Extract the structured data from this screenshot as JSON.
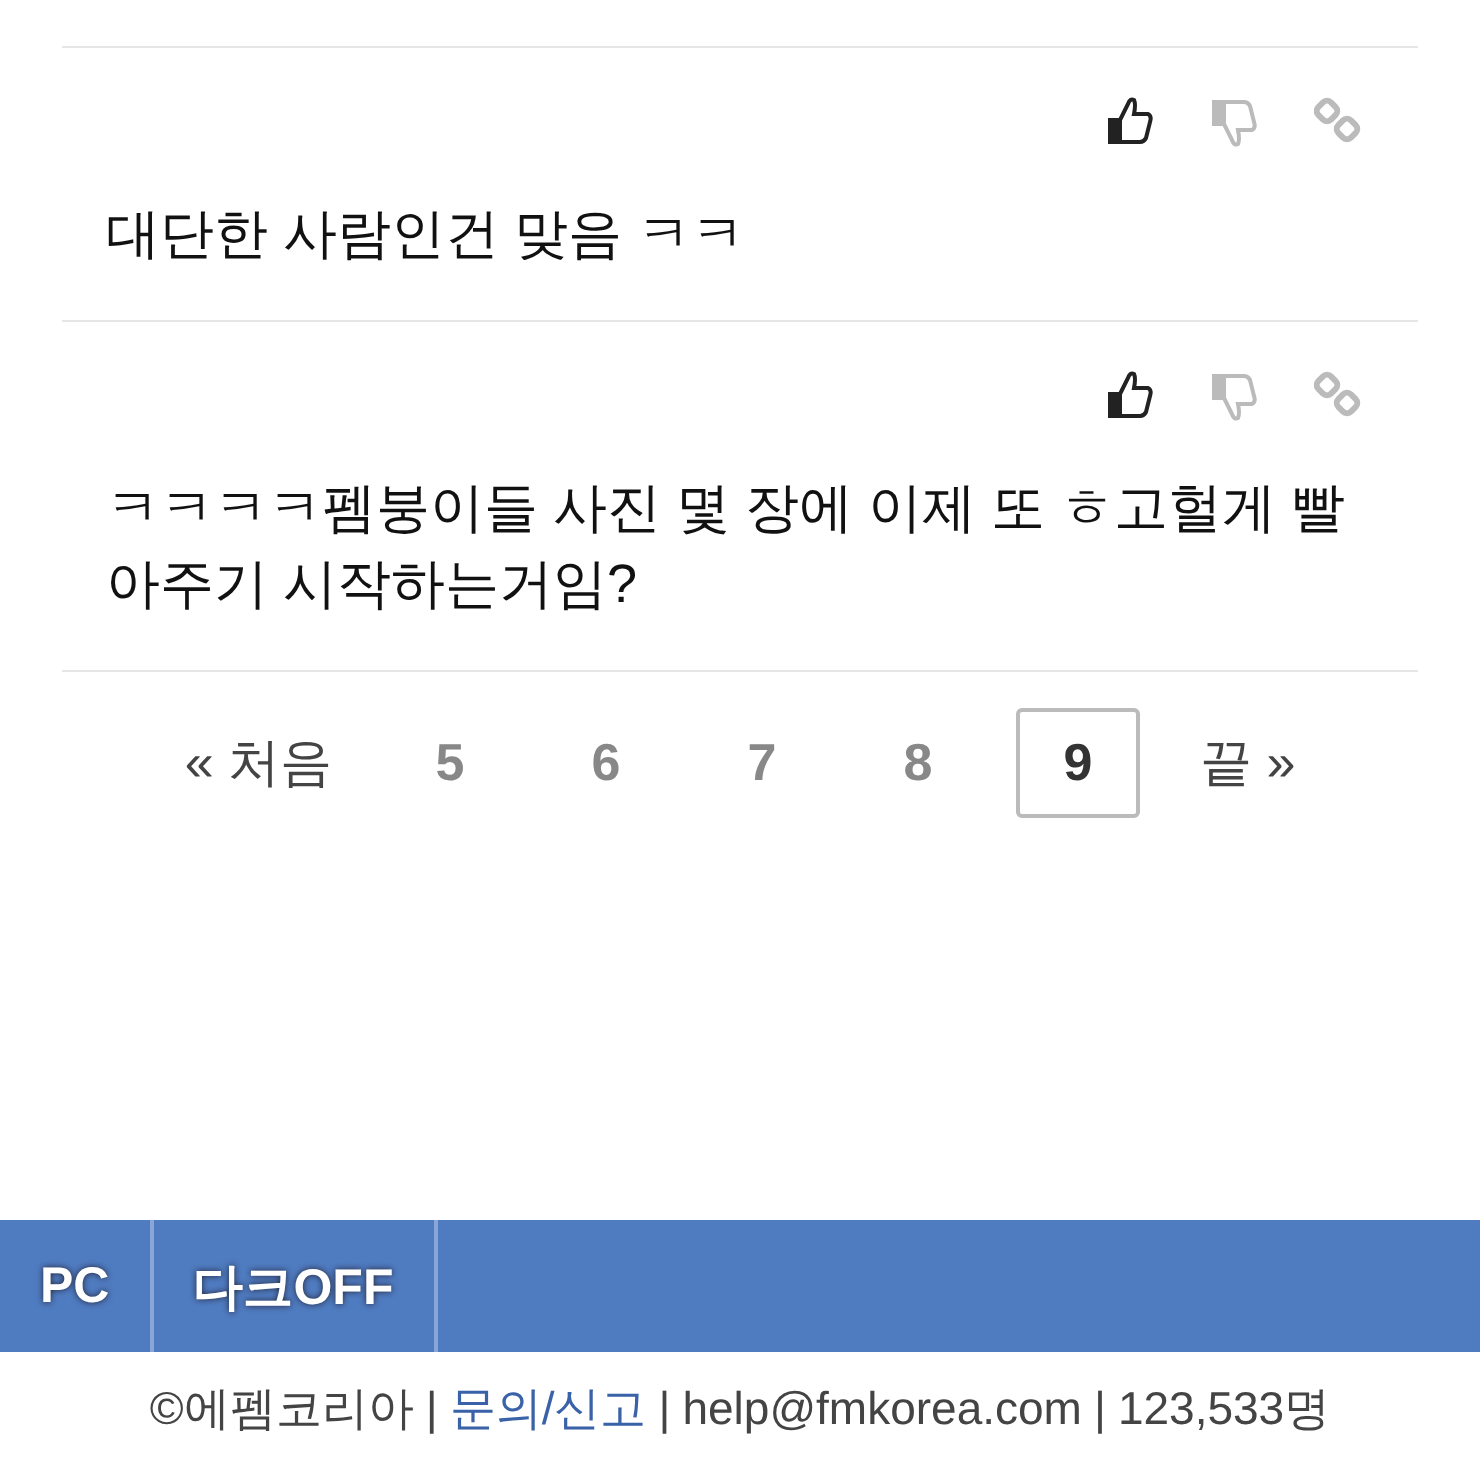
{
  "comments": [
    {
      "text": "대단한 사람인건 맞음 ㅋㅋ"
    },
    {
      "text": "ㅋㅋㅋㅋ펨붕이들 사진 몇 장에 이제 또 ㅎ고헐게 빨아주기 시작하는거임?"
    }
  ],
  "pagination": {
    "first": "« 처음",
    "pages": [
      {
        "label": "5",
        "selected": false
      },
      {
        "label": "6",
        "selected": false
      },
      {
        "label": "7",
        "selected": false
      },
      {
        "label": "8",
        "selected": false
      },
      {
        "label": "9",
        "selected": true
      }
    ],
    "last": "끝 »"
  },
  "bottom_bar": {
    "buttons": [
      "PC",
      "다크OFF"
    ]
  },
  "footer": {
    "items": [
      {
        "kind": "text",
        "text": "©에펨코리아"
      },
      {
        "kind": "separator",
        "text": "|"
      },
      {
        "kind": "link",
        "text": "문의/신고"
      },
      {
        "kind": "separator",
        "text": "|"
      },
      {
        "kind": "text",
        "text": "help@fmkorea.com"
      },
      {
        "kind": "separator",
        "text": "|"
      },
      {
        "kind": "text",
        "text": "123,533명"
      }
    ]
  }
}
